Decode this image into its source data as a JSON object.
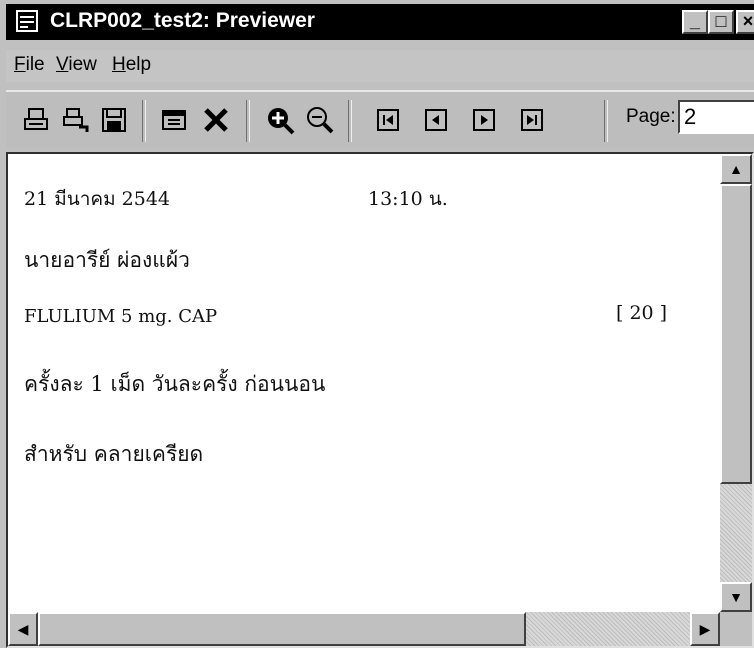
{
  "window": {
    "title": "CLRP002_test2: Previewer",
    "app_icon": "previewer-app-icon",
    "controls": {
      "minimize": "_",
      "maximize": "□",
      "close": "×"
    }
  },
  "menu": {
    "file": {
      "first": "F",
      "rest": "ile"
    },
    "view": {
      "first": "V",
      "rest": "iew"
    },
    "help": {
      "first": "H",
      "rest": "elp"
    }
  },
  "toolbar": {
    "icons": [
      "print-icon",
      "print-setup-icon",
      "save-icon",
      "page-setup-icon",
      "close-document-icon",
      "zoom-in-icon",
      "zoom-out-icon",
      "first-page-icon",
      "previous-page-icon",
      "next-page-icon",
      "last-page-icon"
    ],
    "page_label": "Page:",
    "page_value": "2"
  },
  "document": {
    "date": "21  มีนาคม  2544",
    "time": "13:10  น.",
    "patient_name": "นายอารีย์ ผ่องแผ้ว",
    "drug": "FLULIUM 5 mg. CAP",
    "quantity": "[ 20 ]",
    "dosage": "ครั้งละ 1 เม็ด วันละครั้ง ก่อนนอน",
    "purpose": "สำหรับ  คลายเครียด"
  },
  "scrollbars": {
    "up": "▲",
    "down": "▼",
    "left": "◀",
    "right": "▶"
  }
}
